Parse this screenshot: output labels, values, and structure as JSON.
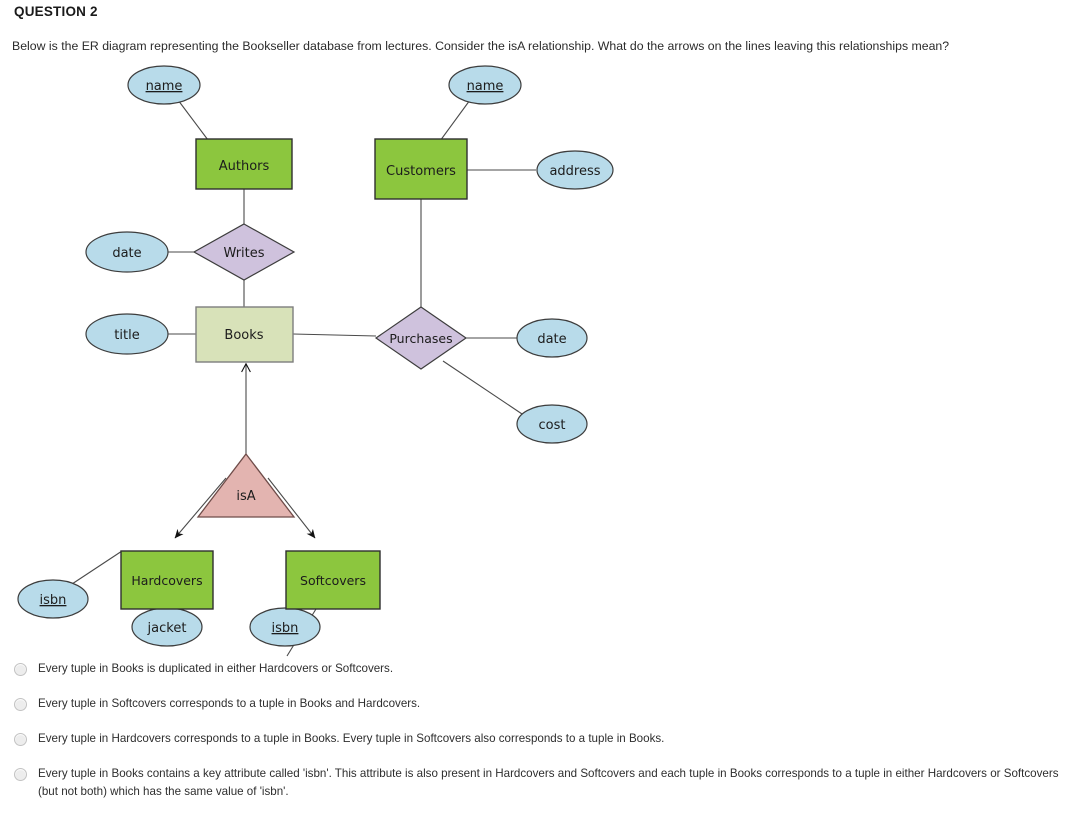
{
  "question": {
    "heading": "QUESTION 2",
    "prompt": "Below is the ER diagram representing the Bookseller database from lectures. Consider the isA relationship. What do the arrows on the lines leaving this relationships mean?"
  },
  "colors": {
    "entity_green": "#8cc63e",
    "entity_books": "#d8e2b9",
    "relationship_purple": "#cfc2dd",
    "attribute_blue": "#b8dbea",
    "isa_pink": "#e3b4b0",
    "stroke_dark": "#3d3d3d",
    "stroke_gray": "#7e7e7e"
  },
  "diagram": {
    "title": "Bookseller ER diagram",
    "entities": [
      {
        "id": "authors",
        "label": "Authors",
        "shape": "rectangle",
        "fill": "#8cc63e"
      },
      {
        "id": "customers",
        "label": "Customers",
        "shape": "rectangle",
        "fill": "#8cc63e"
      },
      {
        "id": "books",
        "label": "Books",
        "shape": "rectangle",
        "fill": "#d8e2b9"
      },
      {
        "id": "hardcovers",
        "label": "Hardcovers",
        "shape": "rectangle",
        "fill": "#8cc63e"
      },
      {
        "id": "softcovers",
        "label": "Softcovers",
        "shape": "rectangle",
        "fill": "#8cc63e"
      }
    ],
    "relationships": [
      {
        "id": "writes",
        "label": "Writes",
        "shape": "diamond",
        "fill": "#cfc2dd"
      },
      {
        "id": "purchases",
        "label": "Purchases",
        "shape": "diamond",
        "fill": "#cfc2dd"
      }
    ],
    "isa": {
      "id": "isa",
      "label": "isA",
      "shape": "triangle",
      "fill": "#e3b4b0"
    },
    "attributes": [
      {
        "id": "authors-name",
        "label": "name",
        "key": true,
        "owner": "authors"
      },
      {
        "id": "customers-name",
        "label": "name",
        "key": true,
        "owner": "customers"
      },
      {
        "id": "customers-address",
        "label": "address",
        "key": false,
        "owner": "customers"
      },
      {
        "id": "writes-date",
        "label": "date",
        "key": false,
        "owner": "writes"
      },
      {
        "id": "books-title",
        "label": "title",
        "key": false,
        "owner": "books"
      },
      {
        "id": "purchases-date",
        "label": "date",
        "key": false,
        "owner": "purchases"
      },
      {
        "id": "purchases-cost",
        "label": "cost",
        "key": false,
        "owner": "purchases"
      },
      {
        "id": "hardcovers-isbn",
        "label": "isbn",
        "key": true,
        "owner": "hardcovers"
      },
      {
        "id": "hardcovers-jacket",
        "label": "jacket",
        "key": false,
        "owner": "hardcovers"
      },
      {
        "id": "softcovers-isbn",
        "label": "isbn",
        "key": true,
        "owner": "softcovers"
      }
    ],
    "edges": [
      {
        "from": "authors-name",
        "to": "authors",
        "arrow": "none"
      },
      {
        "from": "authors",
        "to": "writes",
        "arrow": "none"
      },
      {
        "from": "writes-date",
        "to": "writes",
        "arrow": "none"
      },
      {
        "from": "writes",
        "to": "books",
        "arrow": "none"
      },
      {
        "from": "books-title",
        "to": "books",
        "arrow": "none"
      },
      {
        "from": "books",
        "to": "purchases",
        "arrow": "none"
      },
      {
        "from": "customers-name",
        "to": "customers",
        "arrow": "none"
      },
      {
        "from": "customers",
        "to": "customers-address",
        "arrow": "none"
      },
      {
        "from": "customers",
        "to": "purchases",
        "arrow": "none"
      },
      {
        "from": "purchases",
        "to": "purchases-date",
        "arrow": "none"
      },
      {
        "from": "purchases",
        "to": "purchases-cost",
        "arrow": "none"
      },
      {
        "from": "isa",
        "to": "books",
        "arrow": "open-up"
      },
      {
        "from": "isa",
        "to": "hardcovers",
        "arrow": "filled"
      },
      {
        "from": "isa",
        "to": "softcovers",
        "arrow": "filled"
      },
      {
        "from": "hardcovers",
        "to": "hardcovers-isbn",
        "arrow": "none"
      },
      {
        "from": "hardcovers",
        "to": "hardcovers-jacket",
        "arrow": "none"
      },
      {
        "from": "softcovers",
        "to": "softcovers-isbn",
        "arrow": "none"
      }
    ]
  },
  "answers": [
    {
      "id": "a",
      "selected": false,
      "text": "Every tuple in Books is duplicated in either Hardcovers or Softcovers."
    },
    {
      "id": "b",
      "selected": false,
      "text": "Every tuple in Softcovers corresponds to a tuple in Books and Hardcovers."
    },
    {
      "id": "c",
      "selected": false,
      "text": "Every tuple in Hardcovers corresponds to a tuple in Books. Every tuple in Softcovers also corresponds to a tuple in Books."
    },
    {
      "id": "d",
      "selected": false,
      "text": "Every tuple in Books contains a key attribute called 'isbn'. This attribute is also present in Hardcovers and Softcovers and each tuple in Books corresponds to a tuple in either Hardcovers or Softcovers (but not both) which has the same value of 'isbn'."
    }
  ]
}
